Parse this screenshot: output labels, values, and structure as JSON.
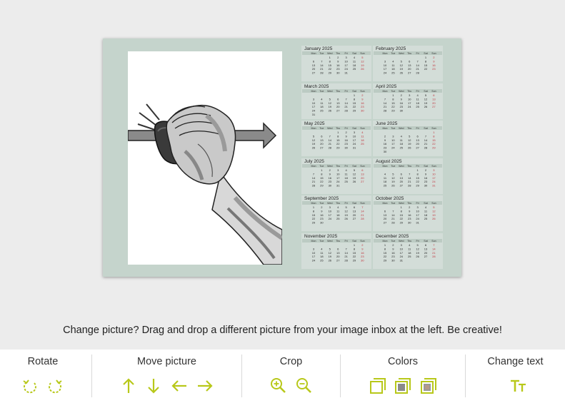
{
  "calendar": {
    "weekdays": [
      "Mon",
      "Tue",
      "Wed",
      "Thu",
      "Fri",
      "Sat",
      "Sun"
    ],
    "months": [
      {
        "name": "January 2025",
        "start": 2,
        "days": 31
      },
      {
        "name": "February 2025",
        "start": 5,
        "days": 28
      },
      {
        "name": "March 2025",
        "start": 5,
        "days": 31
      },
      {
        "name": "April 2025",
        "start": 1,
        "days": 30
      },
      {
        "name": "May 2025",
        "start": 3,
        "days": 31
      },
      {
        "name": "June 2025",
        "start": 6,
        "days": 30
      },
      {
        "name": "July 2025",
        "start": 1,
        "days": 31
      },
      {
        "name": "August 2025",
        "start": 4,
        "days": 31
      },
      {
        "name": "September 2025",
        "start": 0,
        "days": 30
      },
      {
        "name": "October 2025",
        "start": 2,
        "days": 31
      },
      {
        "name": "November 2025",
        "start": 5,
        "days": 30
      },
      {
        "name": "December 2025",
        "start": 0,
        "days": 31
      }
    ]
  },
  "tip": "Change picture? Drag and drop a different picture from your image inbox at the left. Be creative!",
  "toolbar": {
    "rotate": {
      "title": "Rotate",
      "buttons": [
        "rotate-left-icon",
        "rotate-right-icon"
      ]
    },
    "move": {
      "title": "Move picture",
      "buttons": [
        "arrow-up-icon",
        "arrow-down-icon",
        "arrow-left-icon",
        "arrow-right-icon"
      ]
    },
    "crop": {
      "title": "Crop",
      "buttons": [
        "zoom-in-icon",
        "zoom-out-icon"
      ]
    },
    "colors": {
      "title": "Colors",
      "buttons": [
        "color-outline-icon",
        "color-grey-icon",
        "color-mixed-icon"
      ]
    },
    "text": {
      "title": "Change text",
      "buttons": [
        "text-size-icon"
      ]
    }
  },
  "colors": {
    "accent": "#b8c81a",
    "card": "#c5d4cc",
    "sunday": "#c0303a",
    "cell": "#d3ddd8"
  }
}
